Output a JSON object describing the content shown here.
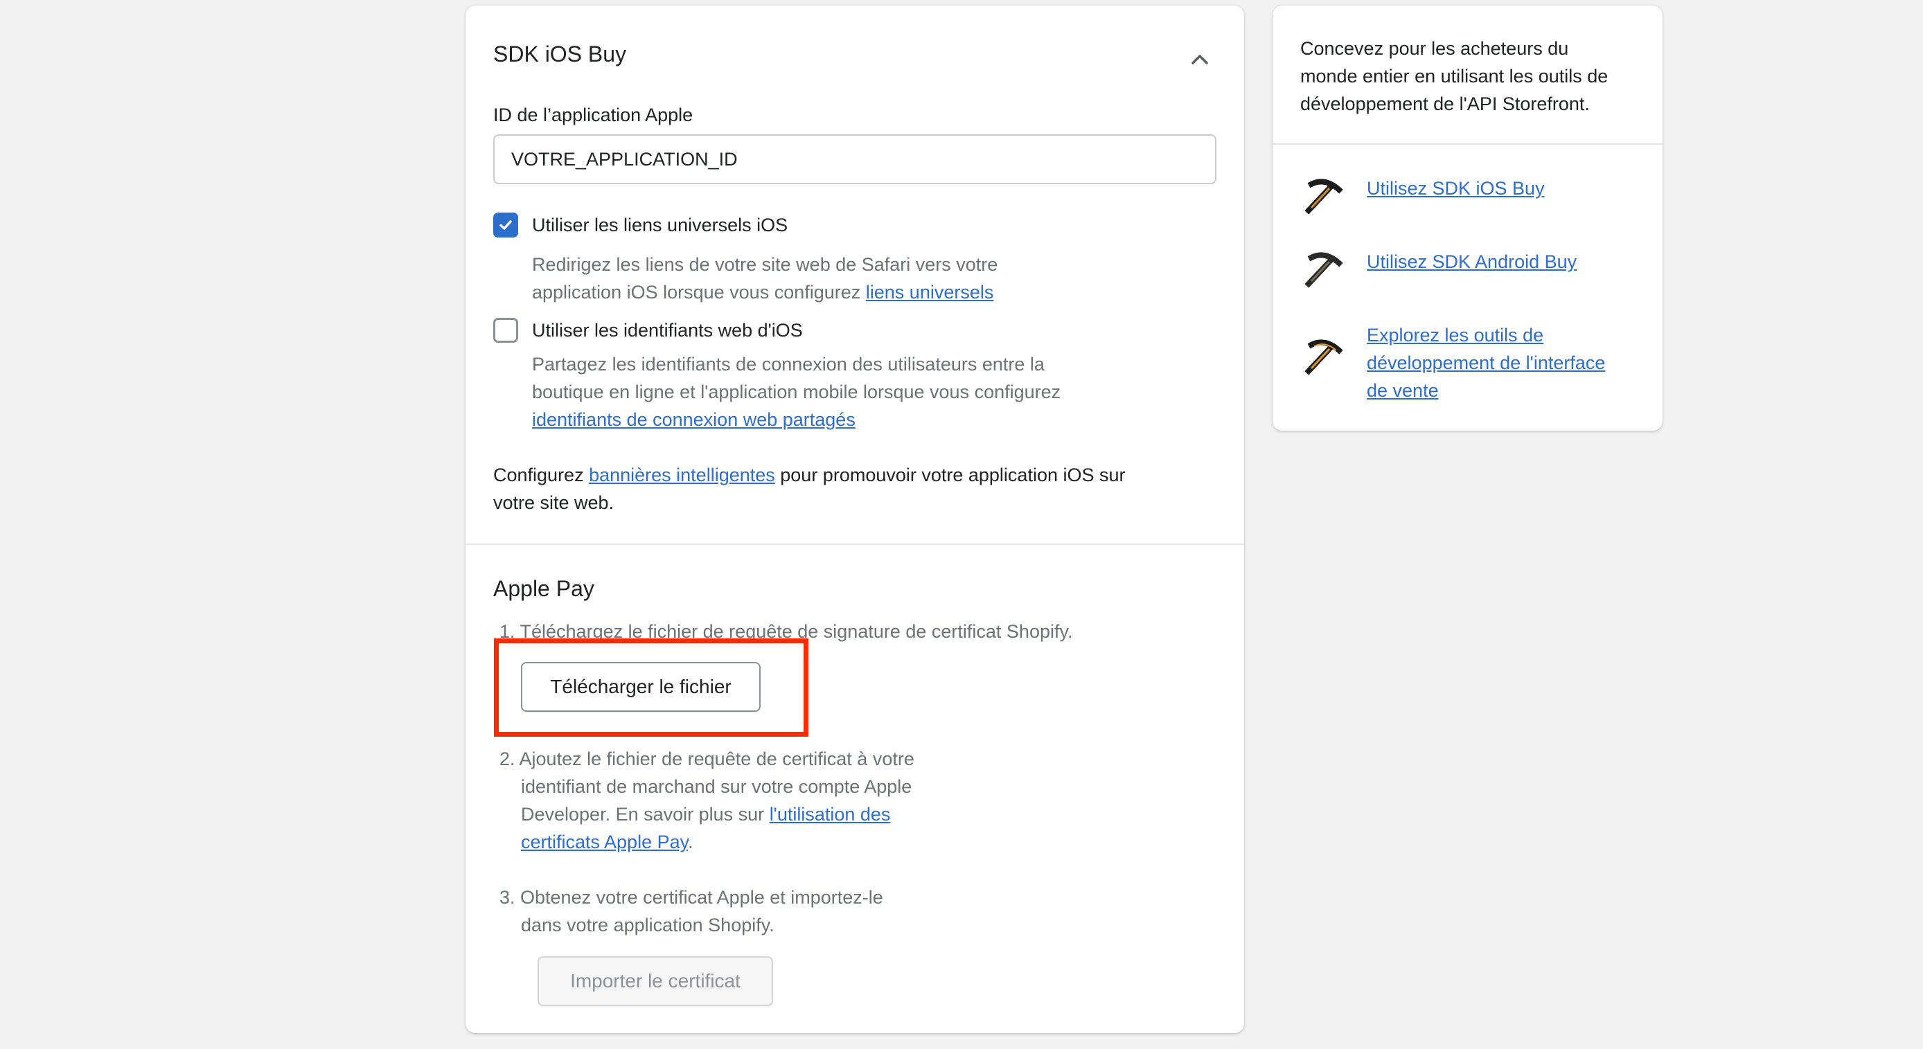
{
  "sdk_section": {
    "title": "SDK iOS Buy",
    "collapse_icon": "chevron-up-icon",
    "app_id_label": "ID de l’application Apple",
    "app_id_value": "VOTRE_APPLICATION_ID",
    "universal_links": {
      "checked": true,
      "label": "Utiliser les liens universels iOS",
      "desc_line1": "Redirigez les liens de votre site web de Safari vers votre",
      "desc_line2_prefix": "application iOS lorsque vous configurez ",
      "desc_link": "liens universels"
    },
    "web_credentials": {
      "checked": false,
      "label": "Utiliser les identifiants web d'iOS",
      "desc_line1": "Partagez les identifiants de connexion des utilisateurs entre la",
      "desc_line2": "boutique en ligne et l'application mobile lorsque vous configurez",
      "desc_link": "identifiants de connexion web partagés"
    },
    "smart_banner": {
      "prefix": "Configurez ",
      "link": "bannières intelligentes",
      "suffix": " pour promouvoir votre application iOS sur",
      "line2": "votre site web."
    }
  },
  "apple_pay": {
    "title": "Apple Pay",
    "step1": "1. Téléchargez le fichier de requête de signature de certificat Shopify.",
    "download_button": "Télécharger le fichier",
    "step2_line1": "2. Ajoutez le fichier de requête de certificat à votre",
    "step2_line2": "identifiant de marchand sur votre compte Apple",
    "step2_line3_prefix": "Developer. En savoir plus sur ",
    "step2_link_part1": "l'utilisation des",
    "step2_link_part2": "certificats Apple Pay",
    "step2_end": ".",
    "step3_line1": "3. Obtenez votre certificat Apple et importez-le",
    "step3_line2": "dans votre application Shopify.",
    "import_button": "Importer le certificat"
  },
  "sidebar": {
    "intro_line1": "Concevez pour les acheteurs du",
    "intro_line2": "monde entier en utilisant les outils de",
    "intro_line3": "développement de l'API Storefront.",
    "tools": [
      {
        "icon": "pickaxe-icon",
        "link": "Utilisez SDK iOS Buy"
      },
      {
        "icon": "pickaxe-icon",
        "link": "Utilisez SDK Android Buy"
      },
      {
        "icon": "pickaxe-icon",
        "link_line1": "Explorez les outils de",
        "link_line2": "développement de l'interface",
        "link_line3": "de vente"
      }
    ]
  },
  "colors": {
    "link": "#2c6ecb",
    "checkbox_checked": "#2c6ecb",
    "highlight": "#ff2a00",
    "background": "#f1f1f1"
  }
}
